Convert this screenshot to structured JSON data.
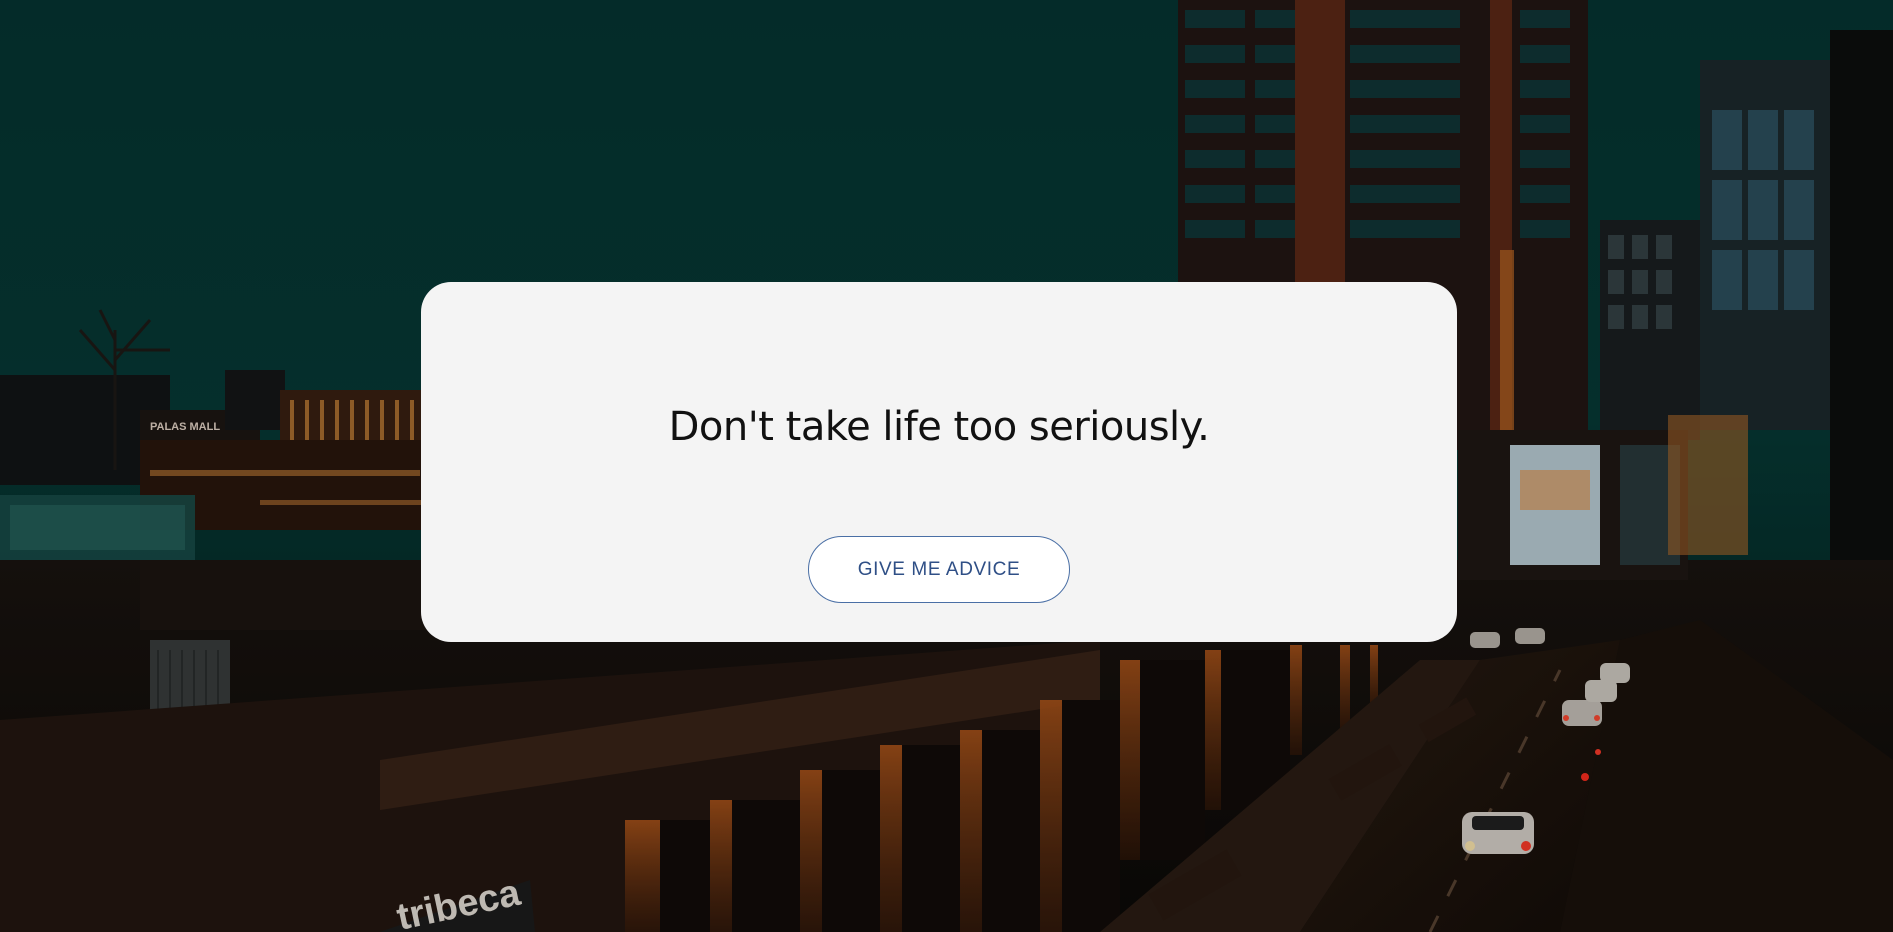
{
  "background": {
    "sky_color": "#063532",
    "signs": {
      "mall": "PALAS MALL",
      "storefront": "tribeca"
    }
  },
  "card": {
    "quote": "Don't take life too seriously.",
    "button_label": "GIVE ME ADVICE"
  },
  "colors": {
    "card_background": "#f4f4f4",
    "button_border": "#4a6fa5",
    "button_text": "#2f4f86",
    "quote_text": "#111111"
  }
}
